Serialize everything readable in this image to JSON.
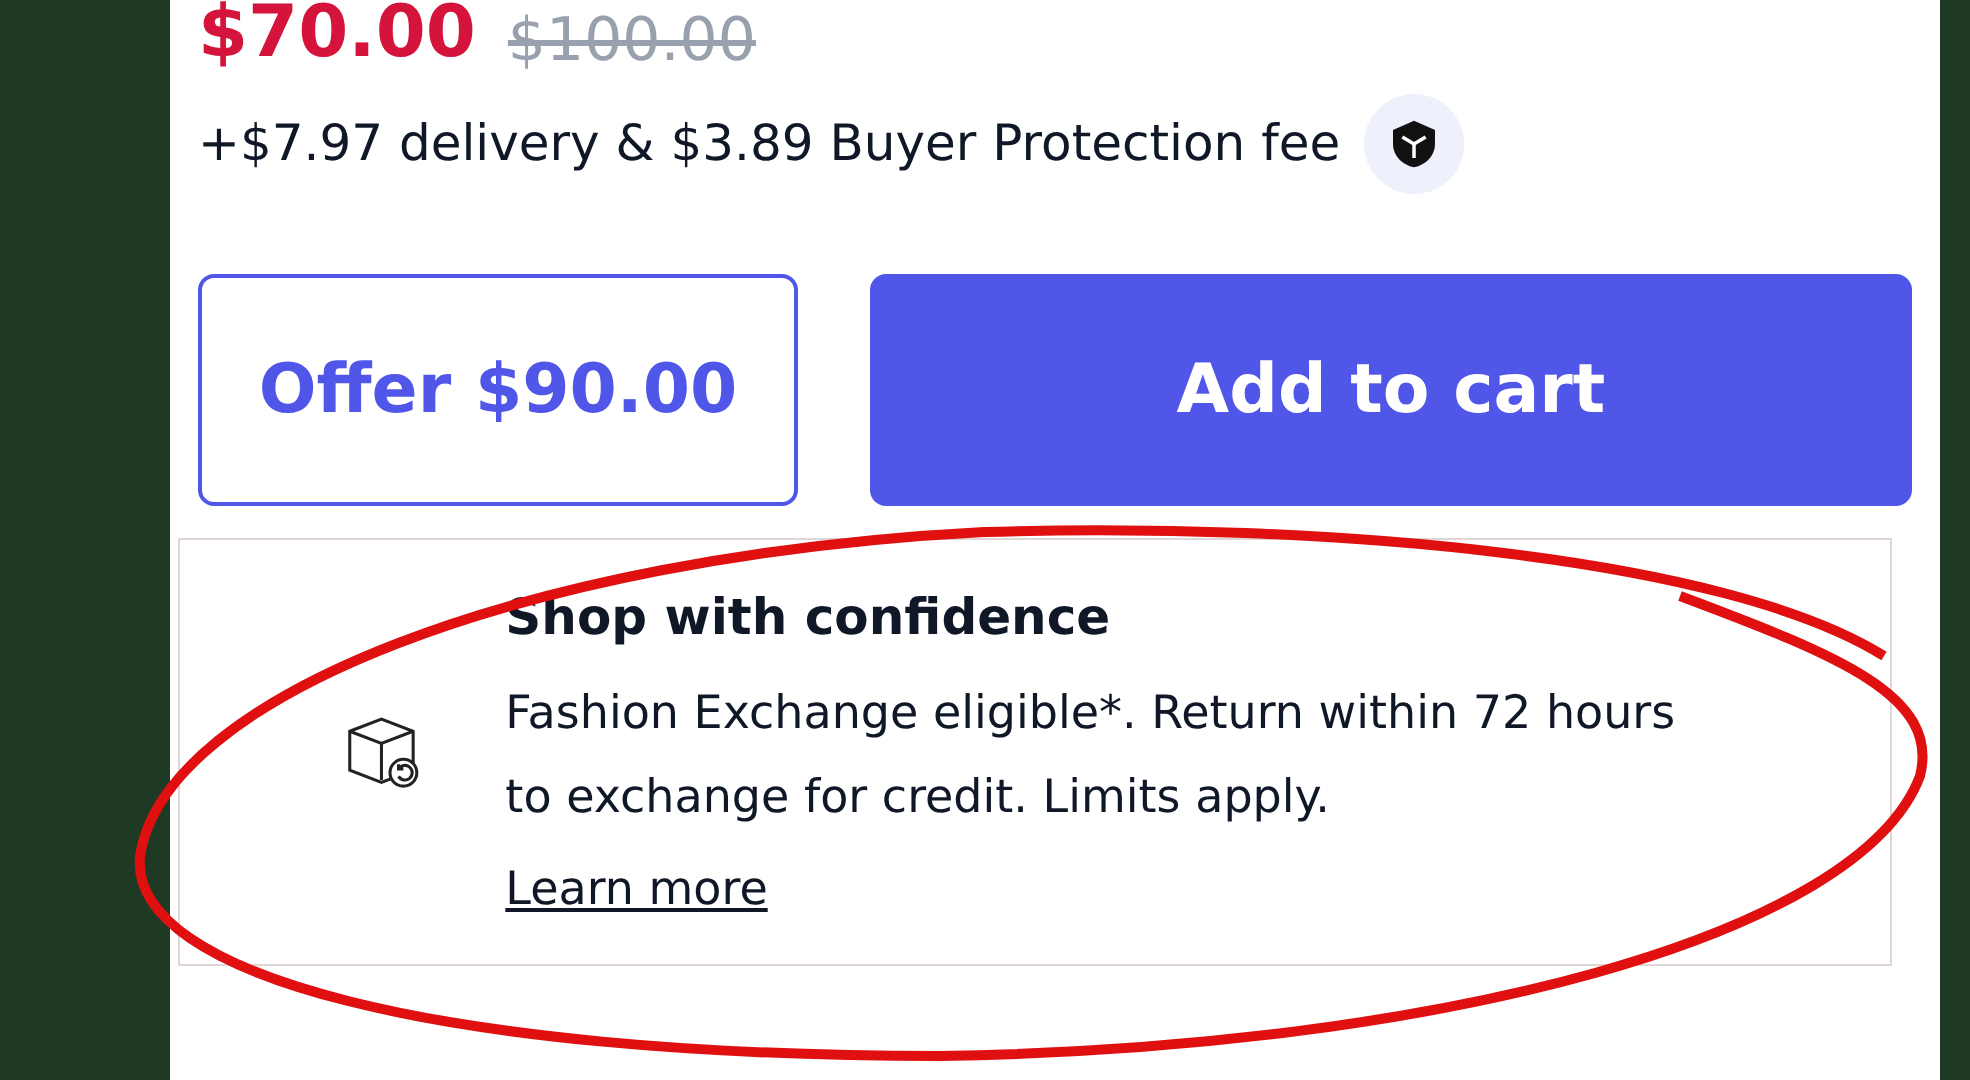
{
  "price": {
    "current": "$70.00",
    "original": "$100.00"
  },
  "fees": "+$7.97 delivery & $3.89 Buyer Protection fee",
  "buttons": [
    {
      "kind": "outline",
      "label": "Offer $90.00"
    },
    {
      "kind": "filled",
      "label": "Add to cart"
    }
  ],
  "confidence": {
    "title": "Shop with confidence",
    "text": "Fashion Exchange eligible*. Return within 72 hours to exchange for credit. Limits apply.",
    "link": "Learn more"
  }
}
